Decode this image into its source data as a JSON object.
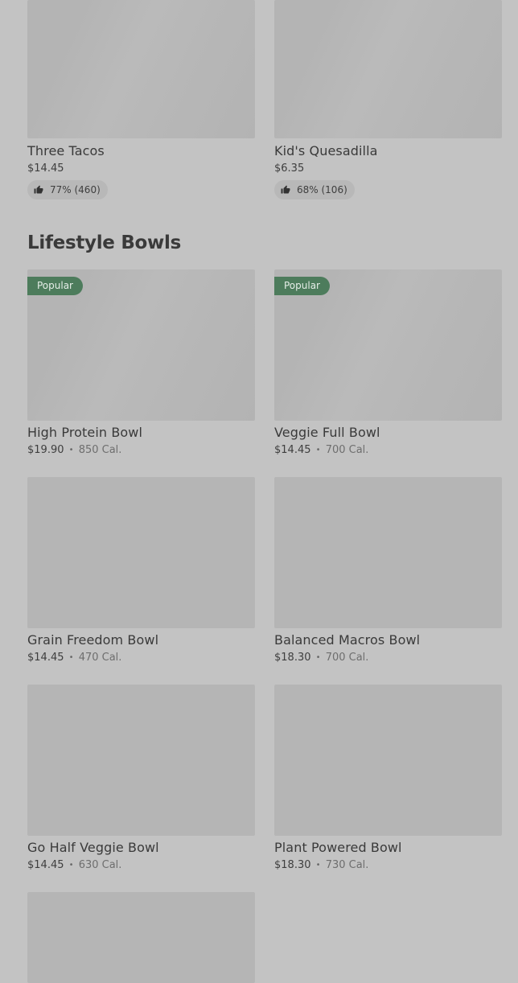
{
  "top_items": [
    {
      "name": "Three Tacos",
      "price": "$14.45",
      "rating": "77% (460)"
    },
    {
      "name": "Kid's Quesadilla",
      "price": "$6.35",
      "rating": "68% (106)"
    }
  ],
  "section": {
    "title": "Lifestyle Bowls",
    "items": [
      {
        "name": "High Protein Bowl",
        "price": "$19.90",
        "calories": "850 Cal.",
        "badge": "Popular"
      },
      {
        "name": "Veggie Full Bowl",
        "price": "$14.45",
        "calories": "700 Cal.",
        "badge": "Popular"
      },
      {
        "name": "Grain Freedom Bowl",
        "price": "$14.45",
        "calories": "470 Cal."
      },
      {
        "name": "Balanced Macros Bowl",
        "price": "$18.30",
        "calories": "700 Cal."
      },
      {
        "name": "Go Half Veggie Bowl",
        "price": "$14.45",
        "calories": "630 Cal."
      },
      {
        "name": "Plant Powered Bowl",
        "price": "$18.30",
        "calories": "730 Cal."
      }
    ],
    "separator": "•"
  },
  "icons": {
    "rating": "thumbs-up-icon"
  }
}
